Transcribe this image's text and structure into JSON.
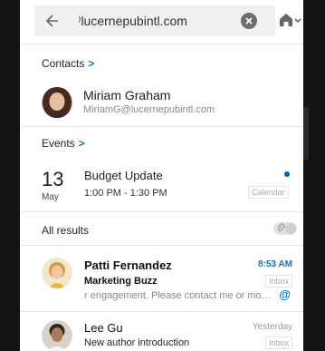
{
  "search": {
    "query": "⁾lucernepubintl.com"
  },
  "colors": {
    "accent": "#0078d4",
    "unread_dot": "#0063b1"
  },
  "icons": {
    "back": "back-arrow-icon",
    "clear": "clear-icon",
    "account": "home-icon"
  },
  "contacts": {
    "header": "Contacts",
    "items": [
      {
        "name": "Miriam Graham",
        "email": "MiriamG@lucernepubintl.com"
      }
    ]
  },
  "events": {
    "header": "Events",
    "items": [
      {
        "day": "13",
        "month": "May",
        "title": "Budget Update",
        "time": "1:00 PM - 1:30 PM",
        "tag": "Calendar",
        "unread": true
      }
    ]
  },
  "all_results": {
    "header": "All results",
    "attachments_filter": "attachment-filter-toggle",
    "messages": [
      {
        "sender": "Patti Fernandez",
        "subject": "Marketing Buzz",
        "preview": "r engagement. Please contact me or more details.",
        "time": "8:53 AM",
        "folder": "Inbox",
        "unread": true,
        "mention": "@"
      },
      {
        "sender": "Lee Gu",
        "subject": "New author introduction",
        "preview": "",
        "time": "Yesterday",
        "folder": "Inbox",
        "unread": false,
        "mention": ""
      }
    ]
  }
}
